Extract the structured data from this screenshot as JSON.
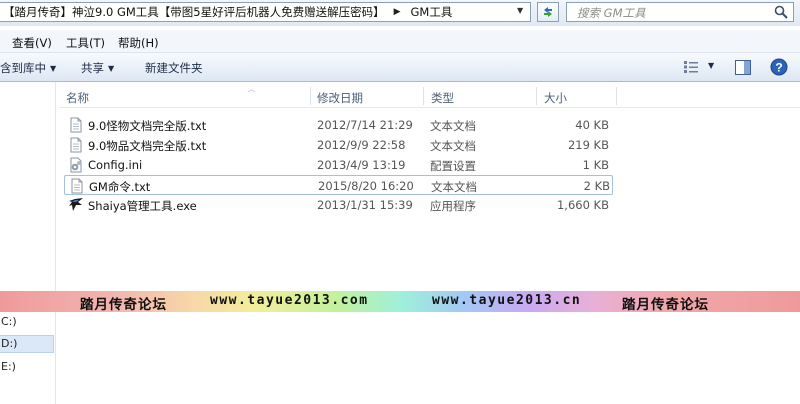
{
  "address_bar": {
    "breadcrumb": "【踏月传奇】神泣9.0 GM工具【带图5星好评后机器人免费赠送解压密码】",
    "separator": "▶",
    "current_folder": "GM工具",
    "dropdown": "▼",
    "search_placeholder": "搜索 GM工具"
  },
  "menu": [
    "查看(V)",
    "工具(T)",
    "帮助(H)"
  ],
  "toolbar": {
    "include_in_library": "含到库中",
    "share": "共享",
    "new_folder": "新建文件夹",
    "caret": "▼"
  },
  "nav": {
    "drives": [
      "C:)",
      "D:)",
      "E:)"
    ]
  },
  "columns": {
    "name": "名称",
    "date": "修改日期",
    "type": "类型",
    "size": "大小"
  },
  "files": [
    {
      "name": "9.0怪物文档完全版.txt",
      "date": "2012/7/14 21:29",
      "type": "文本文档",
      "size": "40 KB",
      "icon": "text-file-icon"
    },
    {
      "name": "9.0物品文档完全版.txt",
      "date": "2012/9/9 22:58",
      "type": "文本文档",
      "size": "219 KB",
      "icon": "text-file-icon"
    },
    {
      "name": "Config.ini",
      "date": "2013/4/9 13:19",
      "type": "配置设置",
      "size": "1 KB",
      "icon": "settings-file-icon"
    },
    {
      "name": "GM命令.txt",
      "date": "2015/8/20 16:20",
      "type": "文本文档",
      "size": "2 KB",
      "icon": "text-file-icon"
    },
    {
      "name": "Shaiya管理工具.exe",
      "date": "2013/1/31 15:39",
      "type": "应用程序",
      "size": "1,660 KB",
      "icon": "app-icon"
    }
  ],
  "banner": {
    "left_text": "踏月传奇论坛",
    "url1": "www.tayue2013.com",
    "url2": "www.tayue2013.cn",
    "right_text": "踏月传奇论坛"
  },
  "colors": {
    "accent": "#2c6ac4",
    "selection_border": "#a5bfe0",
    "toolbar_bg": "#dde7f3"
  }
}
